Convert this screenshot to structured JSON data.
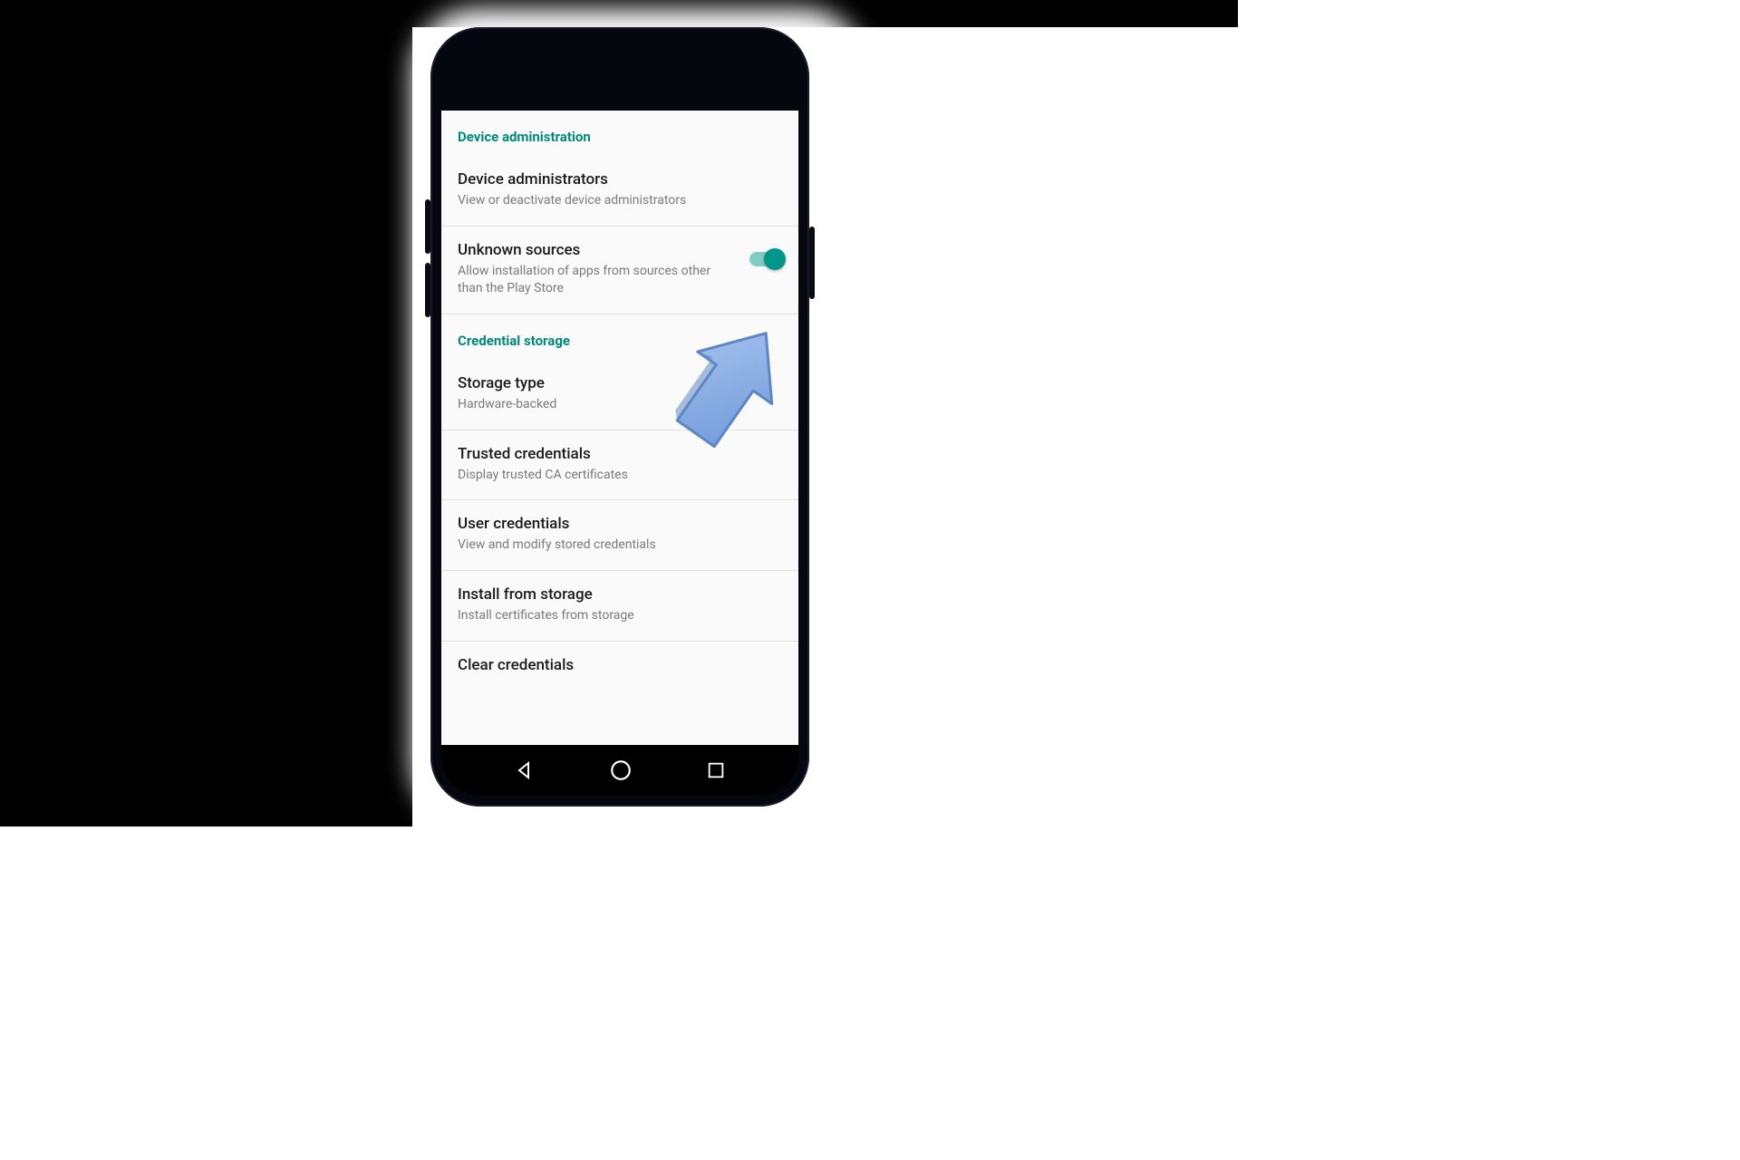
{
  "colors": {
    "accent": "#009688",
    "header": "#00897b",
    "arrow": "#7da8e6"
  },
  "sections": {
    "device_admin": {
      "header": "Device administration",
      "items": [
        {
          "title": "Device administrators",
          "sub": "View or deactivate device administrators"
        },
        {
          "title": "Unknown sources",
          "sub": "Allow installation of apps from sources other than the Play Store",
          "toggle": true,
          "toggle_on": true
        }
      ]
    },
    "cred_storage": {
      "header": "Credential storage",
      "items": [
        {
          "title": "Storage type",
          "sub": "Hardware-backed"
        },
        {
          "title": "Trusted credentials",
          "sub": "Display trusted CA certificates"
        },
        {
          "title": "User credentials",
          "sub": "View and modify stored credentials"
        },
        {
          "title": "Install from storage",
          "sub": "Install certificates from storage"
        },
        {
          "title": "Clear credentials",
          "sub": ""
        }
      ]
    }
  }
}
